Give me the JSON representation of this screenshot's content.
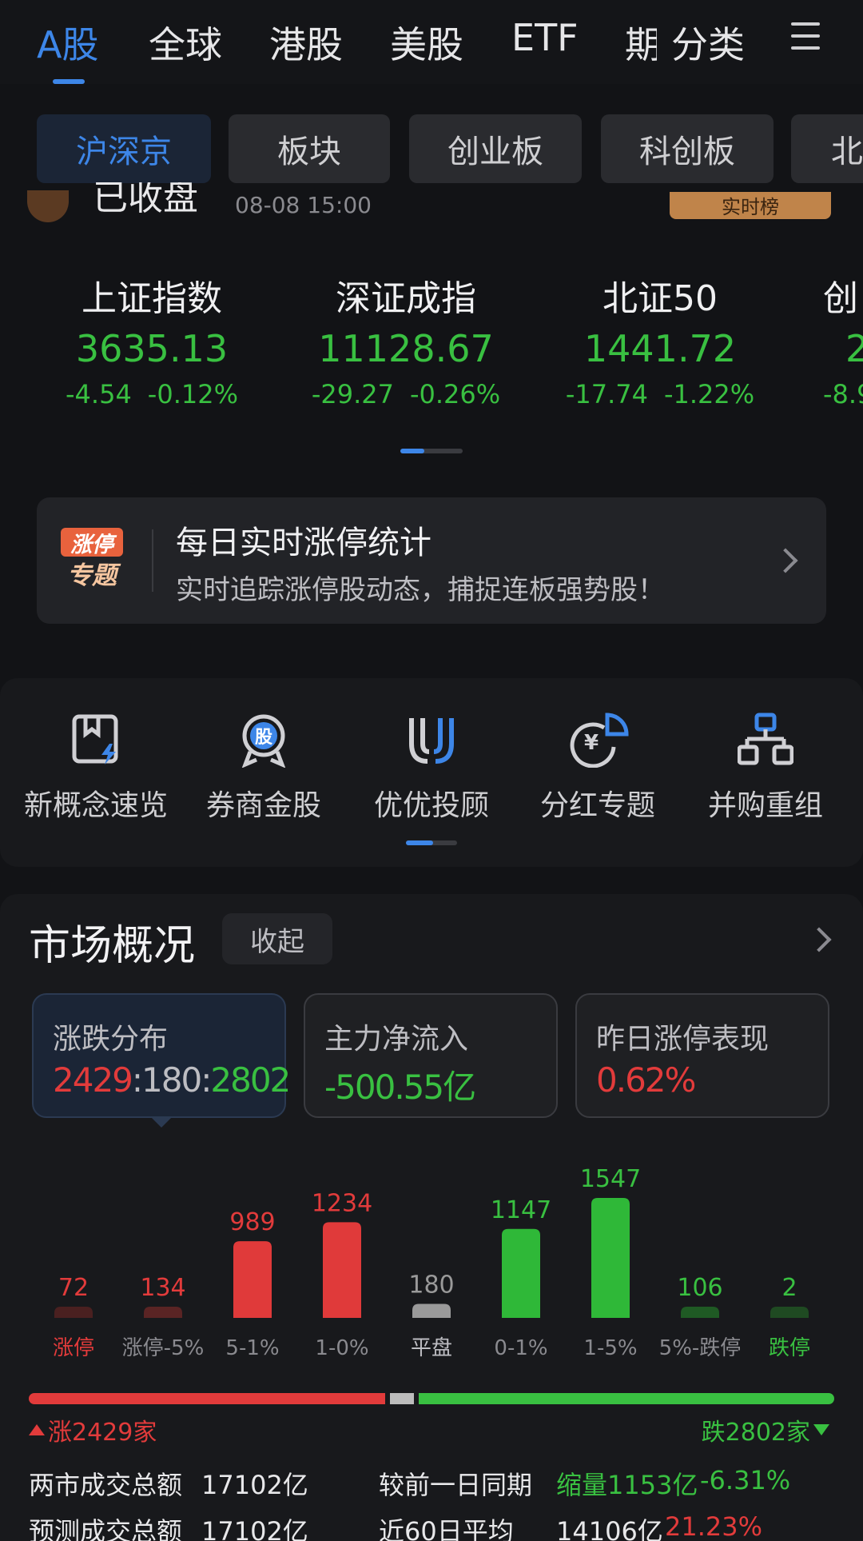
{
  "top_tabs": [
    {
      "label": "A股",
      "active": true
    },
    {
      "label": "全球"
    },
    {
      "label": "港股"
    },
    {
      "label": "美股"
    },
    {
      "label": "ETF"
    },
    {
      "label": "期"
    },
    {
      "label": "分类"
    }
  ],
  "sub_tabs": [
    {
      "label": "沪深京",
      "active": true
    },
    {
      "label": "板块"
    },
    {
      "label": "创业板"
    },
    {
      "label": "科创板"
    },
    {
      "label": "北"
    }
  ],
  "strip": {
    "text": "已收盘",
    "time": "08-08  15:00",
    "badge": "实时榜"
  },
  "indices": [
    {
      "name": "上证指数",
      "value": "3635.13",
      "change": "-4.54",
      "pct": "-0.12%"
    },
    {
      "name": "深证成指",
      "value": "11128.67",
      "change": "-29.27",
      "pct": "-0.26%"
    },
    {
      "name": "北证50",
      "value": "1441.72",
      "change": "-17.74",
      "pct": "-1.22%"
    },
    {
      "name": "创",
      "value": "2",
      "change": "-8.9",
      "pct": ""
    }
  ],
  "banner": {
    "logo_top": "涨停",
    "logo_bottom": "专题",
    "title": "每日实时涨停统计",
    "subtitle": "实时追踪涨停股动态，捕捉连板强势股！"
  },
  "tools": [
    {
      "label": "新概念速览",
      "icon": "lightning-book-icon"
    },
    {
      "label": "券商金股",
      "icon": "medal-icon",
      "glyph": "股"
    },
    {
      "label": "优优投顾",
      "icon": "uu-logo-icon"
    },
    {
      "label": "分红专题",
      "icon": "dividend-pie-icon",
      "glyph": "¥"
    },
    {
      "label": "并购重组",
      "icon": "org-chart-icon"
    }
  ],
  "market": {
    "title": "市场概况",
    "collapse_label": "收起",
    "stats": [
      {
        "label": "涨跌分布",
        "up": "2429",
        "flat": "180",
        "down": "2802",
        "sep": ":"
      },
      {
        "label": "主力净流入",
        "value": "-500.55亿"
      },
      {
        "label": "昨日涨停表现",
        "value": "0.62%"
      }
    ],
    "up_text": "涨2429家",
    "down_text": "跌2802家",
    "up_count": 2429,
    "flat_count": 180,
    "down_count": 2802
  },
  "chart_data": {
    "type": "bar",
    "categories": [
      "涨停",
      "涨停-5%",
      "5-1%",
      "1-0%",
      "平盘",
      "0-1%",
      "1-5%",
      "5%-跌停",
      "跌停"
    ],
    "values": [
      72,
      134,
      989,
      1234,
      180,
      1147,
      1547,
      106,
      2
    ],
    "colors": [
      "#4a2020",
      "#5a2424",
      "#e03a3a",
      "#e03a3a",
      "#9a9a9a",
      "#2fb838",
      "#2fb838",
      "#1f5a24",
      "#1f4a22"
    ],
    "label_colors": [
      "#e23b3b",
      "#e23b3b",
      "#e23b3b",
      "#e23b3b",
      "#9a9a9a",
      "#39c041",
      "#39c041",
      "#39c041",
      "#39c041"
    ],
    "cat_colors": [
      "#e23b3b",
      "#8a8a8f",
      "#8a8a8f",
      "#8a8a8f",
      "#bdbdc2",
      "#8a8a8f",
      "#8a8a8f",
      "#8a8a8f",
      "#39c041"
    ],
    "title": "",
    "xlabel": "",
    "ylabel": "",
    "ylim": [
      0,
      1547
    ]
  },
  "volume": {
    "row1": {
      "label": "两市成交总额",
      "value": "17102亿",
      "label2": "较前一日同期",
      "change": "缩量1153亿",
      "pct": "-6.31%"
    },
    "row2": {
      "label": "预测成交总额",
      "value": "17102亿",
      "label2": "近60日平均",
      "value2": "14106亿",
      "pct": "21.23%"
    }
  },
  "colors": {
    "accent": "#3d86e8",
    "up": "#e23b3b",
    "down": "#39c041",
    "bg": "#121316"
  }
}
